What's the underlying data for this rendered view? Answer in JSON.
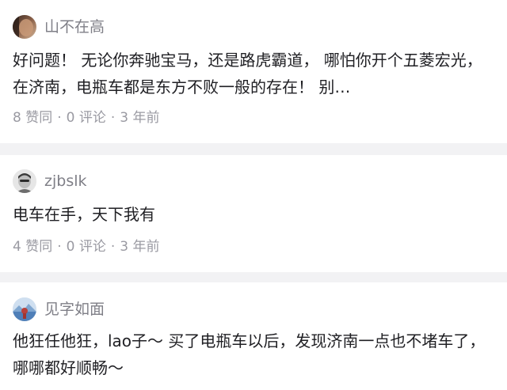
{
  "comments": [
    {
      "username": "山不在高",
      "avatar_icon": "avatar-photo-warm-icon",
      "text": "好问题！ 无论你奔驰宝马，还是路虎霸道， 哪怕你开个五菱宏光， 在济南，电瓶车都是东方不败一般的存在！ 别…",
      "likes": "8 赞同",
      "replies": "0 评论",
      "time": "3 年前",
      "separator": "·"
    },
    {
      "username": "zjbslk",
      "avatar_icon": "avatar-photo-gray-icon",
      "text": "电车在手，天下我有",
      "likes": "4 赞同",
      "replies": "0 评论",
      "time": "3 年前",
      "separator": "·"
    },
    {
      "username": "见字如面",
      "avatar_icon": "avatar-photo-scenery-icon",
      "text": "他狂任他狂，lao子～ 买了电瓶车以后，发现济南一点也不堵车了，哪哪都好顺畅～"
    }
  ],
  "colors": {
    "background": "#f2f2f4",
    "card": "#ffffff",
    "username": "#7f7f87",
    "text": "#1f1f23",
    "meta": "#9a9aa2"
  }
}
